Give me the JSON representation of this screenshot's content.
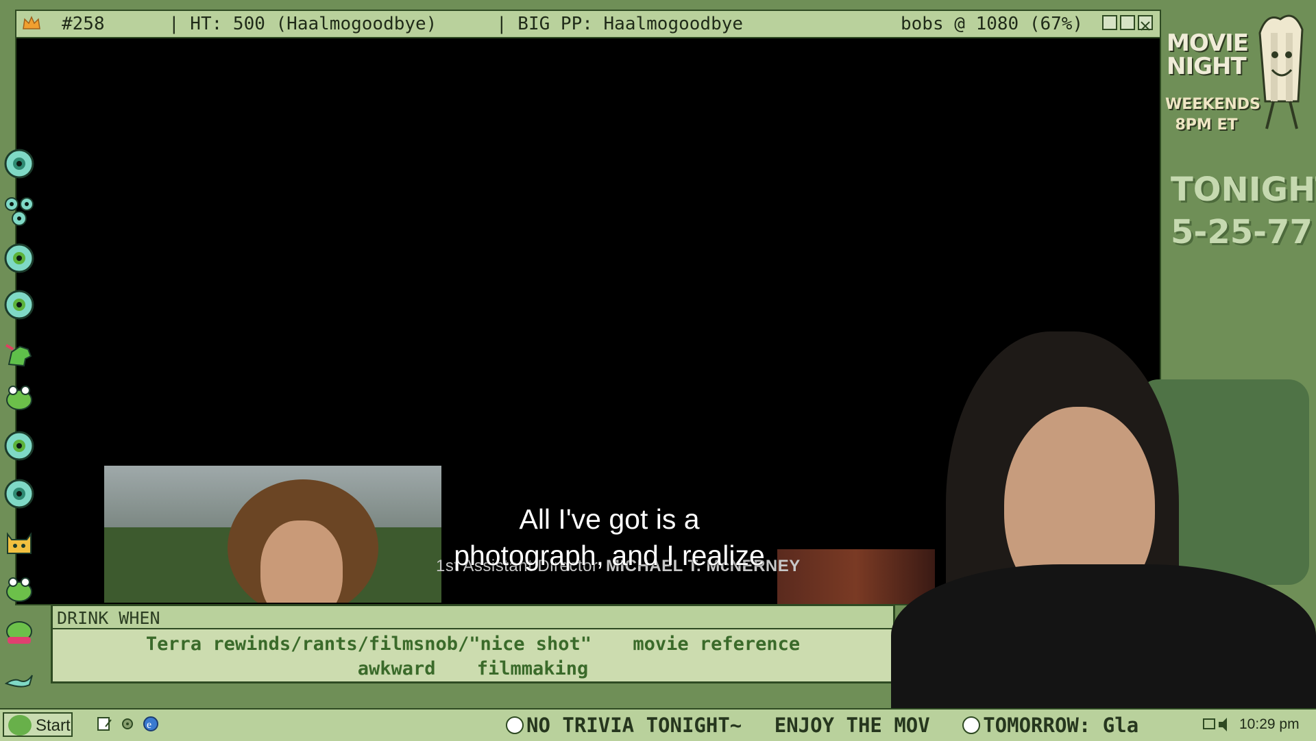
{
  "window": {
    "counter": "#258",
    "ht": "| HT: 500 (Haalmogoodbye)",
    "big_pp": "| BIG PP: Haalmogoodbye",
    "status": "bobs @ 1080 (67%)"
  },
  "video": {
    "subtitle_line1": "All I've got is a",
    "subtitle_line2": "photograph, and I realize",
    "credit_role": "1st Assistant Director",
    "credit_name": "MICHAEL T. McNERNEY"
  },
  "drink_panel": {
    "title": "DRINK WHEN",
    "rules_line1": [
      "Terra rewinds/rants/filmsnob/\"nice shot\"",
      "movie reference"
    ],
    "rules_line2": [
      "awkward",
      "filmmaking"
    ]
  },
  "promo": {
    "line1": "MOVIE",
    "line2": "NIGHT",
    "schedule1": "WEEKENDS",
    "schedule2": "8PM ET",
    "tonight_label": "TONIGHT:",
    "tonight_title": "5-25-77"
  },
  "taskbar": {
    "start_label": "Start",
    "ticker_items": [
      "NO TRIVIA TONIGHT~",
      "ENJOY THE MOV",
      "TOMORROW: Gla"
    ],
    "clock": "10:29 pm"
  },
  "left_icons": [
    "eyeball-icon",
    "eyeballs-cluster-icon",
    "eyeball-icon",
    "eyeball-icon",
    "dinosaur-icon",
    "frog-icon",
    "eyeball-icon",
    "eyeball-icon",
    "cat-icon",
    "frog-icon",
    "frog-icon",
    "lizard-icon"
  ],
  "colors": {
    "background": "#6f8f57",
    "titlebar": "#b9d19c",
    "border": "#2e4a22",
    "drink_text": "#3a6a2a"
  }
}
